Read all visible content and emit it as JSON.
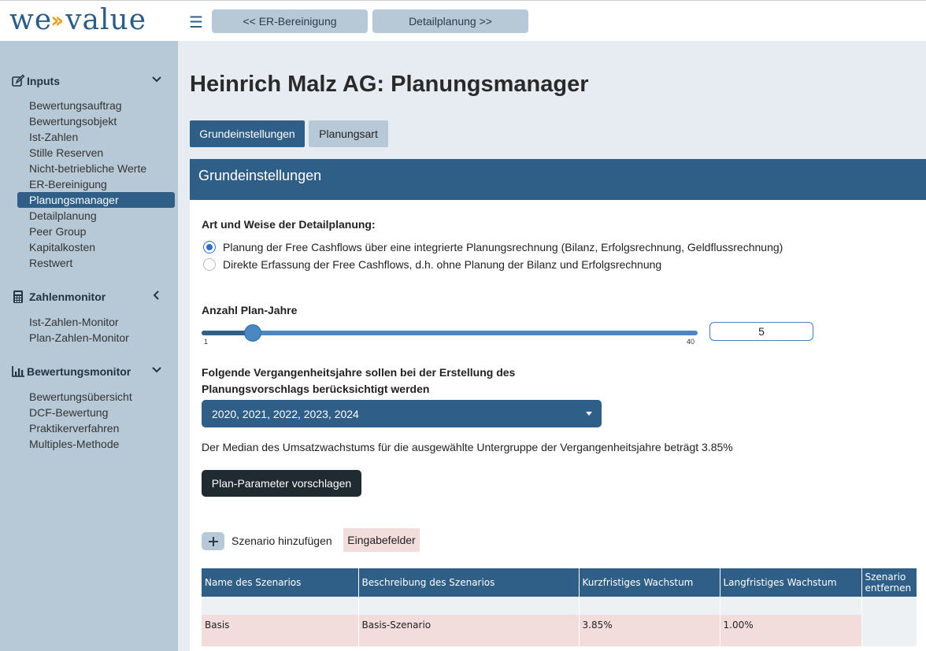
{
  "header": {
    "logo_left": "we",
    "logo_right": "value",
    "prev_button": "<< ER-Bereinigung",
    "next_button": "Detailplanung >>"
  },
  "sidebar": {
    "inputs": {
      "title": "Inputs",
      "items": [
        "Bewertungsauftrag",
        "Bewertungsobjekt",
        "Ist-Zahlen",
        "Stille Reserven",
        "Nicht-betriebliche Werte",
        "ER-Bereinigung",
        "Planungsmanager",
        "Detailplanung",
        "Peer Group",
        "Kapitalkosten",
        "Restwert"
      ]
    },
    "zahlenmonitor": {
      "title": "Zahlenmonitor",
      "items": [
        "Ist-Zahlen-Monitor",
        "Plan-Zahlen-Monitor"
      ]
    },
    "bewertungsmonitor": {
      "title": "Bewertungsmonitor",
      "items": [
        "Bewertungsübersicht",
        "DCF-Bewertung",
        "Praktikerverfahren",
        "Multiples-Methode"
      ]
    },
    "active_item": "Planungsmanager"
  },
  "main": {
    "title": "Heinrich Malz AG: Planungsmanager",
    "tabs": [
      "Grundeinstellungen",
      "Planungsart"
    ],
    "panel_title": "Grundeinstellungen",
    "planning_label": "Art und Weise der Detailplanung:",
    "radio_options": [
      "Planung der Free Cashflows über eine integrierte Planungsrechnung (Bilanz, Erfolgsrechnung, Geldflussrechnung)",
      "Direkte Erfassung der Free Cashflows, d.h. ohne Planung der Bilanz und Erfolgsrechnung"
    ],
    "plan_years_label": "Anzahl Plan-Jahre",
    "slider": {
      "min": "1",
      "max": "40",
      "value": 5
    },
    "plan_years_value": "5",
    "past_years_label_1": "Folgende Vergangenheitsjahre sollen bei der Erstellung des",
    "past_years_label_2": "Planungsvorschlags berücksichtigt werden",
    "selected_years": "2020, 2021, 2022, 2023, 2024",
    "median_text": "Der Median des Umsatzwachstums für die ausgewählte Untergruppe der Vergangenheitsjahre beträgt 3.85%",
    "suggest_button": "Plan-Parameter vorschlagen",
    "add_scenario_label": "Szenario hinzufügen",
    "input_fields_tag": "Eingabefelder",
    "table": {
      "headers": [
        "Name des Szenarios",
        "Beschreibung des Szenarios",
        "Kurzfristiges Wachstum",
        "Langfristiges Wachstum",
        "Szenario",
        "entfernen"
      ],
      "rows": [
        {
          "name": "Basis",
          "description": "Basis-Szenario",
          "short_growth": "3.85%",
          "long_growth": "1.00%"
        }
      ]
    }
  }
}
